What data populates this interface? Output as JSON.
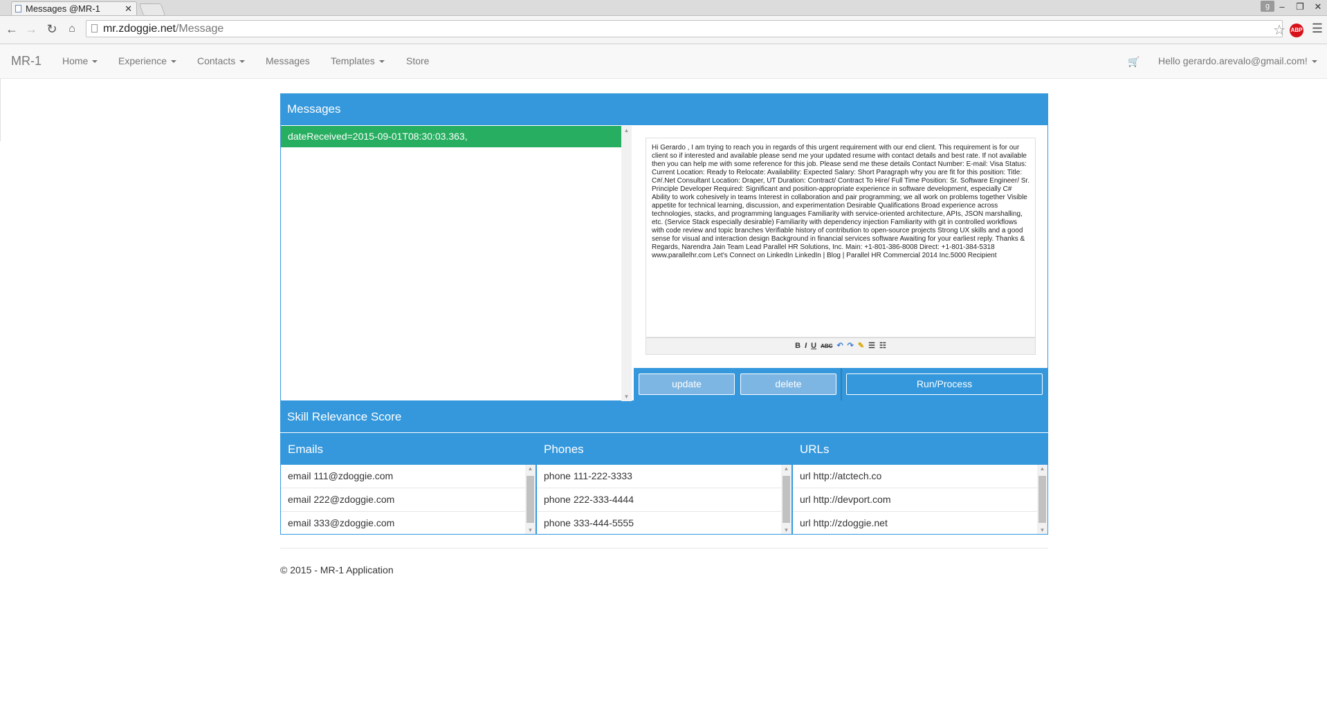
{
  "browser": {
    "tab_title": "Messages @MR-1",
    "tab_close": "✕",
    "url_host": "mr.zdoggie.net",
    "url_path": "/Message"
  },
  "navbar": {
    "brand": "MR-1",
    "items": [
      {
        "label": "Home",
        "dropdown": true
      },
      {
        "label": "Experience",
        "dropdown": true
      },
      {
        "label": "Contacts",
        "dropdown": true
      },
      {
        "label": "Messages",
        "dropdown": false
      },
      {
        "label": "Templates",
        "dropdown": true
      },
      {
        "label": "Store",
        "dropdown": false
      }
    ],
    "user": "Hello gerardo.arevalo@gmail.com!"
  },
  "messages": {
    "title": "Messages",
    "selected_item": "dateReceived=2015-09-01T08:30:03.363,",
    "body": "Hi Gerardo , I am trying to reach you in regards of this urgent requirement with our end client. This requirement is for our client so if interested and available please send me your updated resume with contact details and best rate. If not available then you can help me with some reference for this job. Please send me these details Contact Number: E-mail: Visa Status: Current Location: Ready to Relocate: Availability: Expected Salary: Short Paragraph why you are fit for this position: Title: C#/.Net Consultant Location: Draper, UT Duration: Contract/ Contract To Hire/ Full Time Position: Sr. Software Engineer/ Sr. Principle Developer Required: Significant and position-appropriate experience in software development, especially C# Ability to work cohesively in teams Interest in collaboration and pair programming; we all work on problems together Visible appetite for technical learning, discussion, and experimentation Desirable Qualifications Broad experience across technologies, stacks, and programming languages Familiarity with service-oriented architecture, APIs, JSON marshalling, etc. (Service Stack especially desirable) Familiarity with dependency injection Familiarity with git in controlled workflows with code review and topic branches Verifiable history of contribution to open-source projects Strong UX skills and a good sense for visual and interaction design Background in financial services software Awaiting for your earliest reply. Thanks & Regards, Narendra Jain Team Lead Parallel HR Solutions, Inc. Main: +1-801-386-8008 Direct: +1-801-384-5318 www.parallelhr.com Let's Connect on LinkedIn LinkedIn | Blog | Parallel HR Commercial 2014 Inc.5000 Recipient",
    "buttons": {
      "update": "update",
      "delete": "delete",
      "run": "Run/Process"
    }
  },
  "skill": {
    "title": "Skill Relevance Score",
    "emails": {
      "header": "Emails",
      "rows": [
        "email 111@zdoggie.com",
        "email 222@zdoggie.com",
        "email 333@zdoggie.com"
      ]
    },
    "phones": {
      "header": "Phones",
      "rows": [
        "phone 111-222-3333",
        "phone 222-333-4444",
        "phone 333-444-5555"
      ]
    },
    "urls": {
      "header": "URLs",
      "rows": [
        "url http://atctech.co",
        "url http://devport.com",
        "url http://zdoggie.net"
      ]
    }
  },
  "footer": "© 2015 - MR-1 Application"
}
